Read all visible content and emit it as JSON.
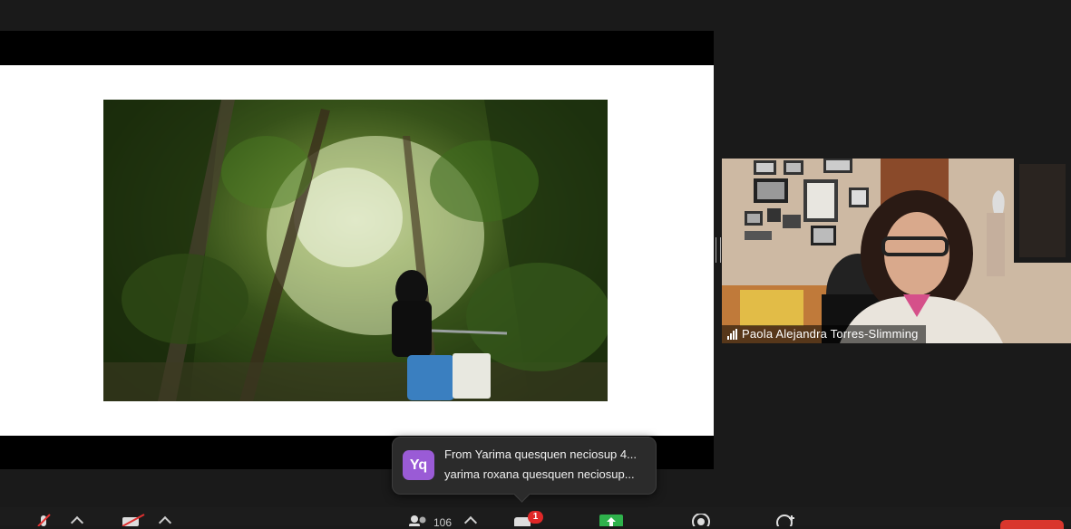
{
  "chat_toast": {
    "avatar_initials": "Yq",
    "avatar_color": "#9a5bd6",
    "line1": "From Yarima quesquen neciosup 4...",
    "line2": "yarima roxana quesquen neciosup..."
  },
  "speaker": {
    "name": "Paola Alejandra Torres-Slimming"
  },
  "toolbar": {
    "participants_count": "106",
    "chat_badge": "1",
    "accent_green": "#2fb24c",
    "end_color": "#d9362d"
  },
  "icons": [
    "mic-muted-icon",
    "video-off-icon",
    "participants-icon",
    "chat-icon",
    "share-screen-icon",
    "record-icon",
    "reactions-icon"
  ]
}
